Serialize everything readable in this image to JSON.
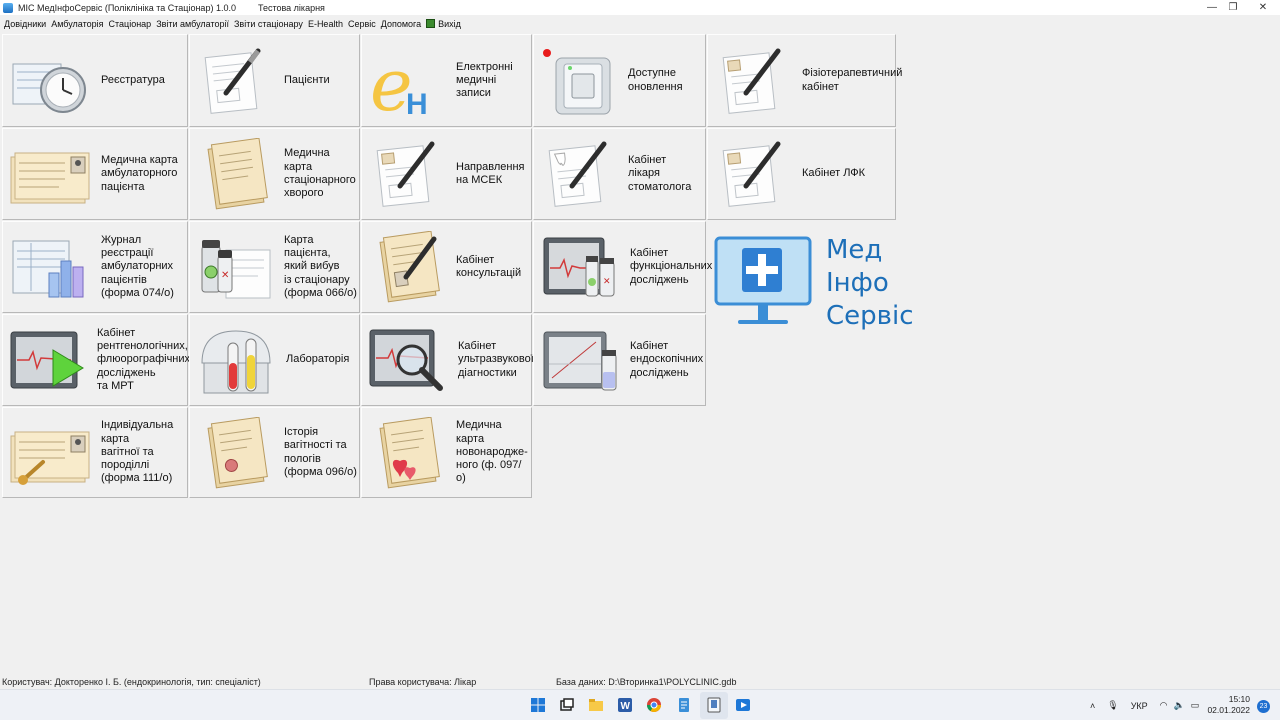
{
  "window": {
    "title": "МІС МедІнфоСервіс (Поліклініка та Стаціонар) 1.0.0",
    "subtitle": "Тестова лікарня",
    "controls": [
      "—",
      "❐",
      "✕"
    ]
  },
  "menu": {
    "items": [
      "Довідники",
      "Амбулаторія",
      "Стаціонар",
      "Звіти амбулаторії",
      "Звіти стаціонару",
      "E-Health",
      "Сервіс",
      "Допомога"
    ],
    "exit": "Вихід"
  },
  "tiles": [
    {
      "label": "Реєстратура",
      "icon": "clock-icon"
    },
    {
      "label": "Пацієнти",
      "icon": "document-pen-icon"
    },
    {
      "label": "Електронні\nмедичні\nзаписи",
      "icon": "ehealth-logo-icon"
    },
    {
      "label": "Доступне\nоновлення",
      "icon": "switch-icon"
    },
    {
      "label": "Фізіотерапевтичний\nкабінет",
      "icon": "document-pen-icon"
    },
    {
      "label": "Медична карта\nамбулаторного\nпацієнта",
      "icon": "medical-card-icon"
    },
    {
      "label": "Медична карта\nстаціонарного\nхворого",
      "icon": "folder-card-icon"
    },
    {
      "label": "Направлення\nна МСЕК",
      "icon": "document-pen-icon"
    },
    {
      "label": "Кабінет\nлікаря\nстоматолога",
      "icon": "dental-document-icon"
    },
    {
      "label": "Кабінет ЛФК",
      "icon": "document-pen-icon"
    },
    {
      "label": "Журнал\nреєстрації\nамбулаторних\nпацієнтів\n(форма 074/о)",
      "icon": "journal-chart-icon"
    },
    {
      "label": "Карта пацієнта,\nякий вибув\nіз стаціонару\n(форма 066/о)",
      "icon": "pills-card-icon"
    },
    {
      "label": "Кабінет\nконсультацій",
      "icon": "folder-pen-icon"
    },
    {
      "label": "Кабінет\nфункціональних\nдосліджень",
      "icon": "monitor-vials-icon"
    },
    {
      "label": "Кабінет\nрентгенологічних,\nфлюорографічних\nдосліджень\nта МРТ",
      "icon": "xray-monitor-icon"
    },
    {
      "label": "Лабораторія",
      "icon": "test-tubes-icon"
    },
    {
      "label": "Кабінет\nультразвукової\nдіагностики",
      "icon": "ultrasound-monitor-icon"
    },
    {
      "label": "Кабінет\nендоскопічних\nдосліджень",
      "icon": "endoscopy-monitor-icon"
    },
    {
      "label": "Індивідуальна\nкарта\nвагітної та\nпороділлі\n(форма 111/о)",
      "icon": "pregnancy-card-icon"
    },
    {
      "label": "Історія\nвагітності та\nпологів\n(форма 096/о)",
      "icon": "folder-card-icon"
    },
    {
      "label": "Медична\nкарта\nновонародже-\nного (ф. 097/о)",
      "icon": "newborn-card-icon"
    }
  ],
  "logo": {
    "text": "Мед\nІнфо\nСервіс",
    "color": "#1d6fb8"
  },
  "status": {
    "user": "Користувач: Докторенко І. Б. (ендокринологія, тип: спеціаліст)",
    "rights": "Права користувача: Лікар",
    "db": "База даних: D:\\Вторинка1\\POLYCLINIC.gdb"
  },
  "taskbar": {
    "apps": [
      "windows-start-icon",
      "taskview-icon",
      "file-explorer-icon",
      "word-icon",
      "chrome-icon",
      "notepad-icon",
      "mis-app-icon",
      "media-icon"
    ],
    "lang": "УКР",
    "time": "15:10",
    "date": "02.01.2022",
    "notifications": "23"
  }
}
